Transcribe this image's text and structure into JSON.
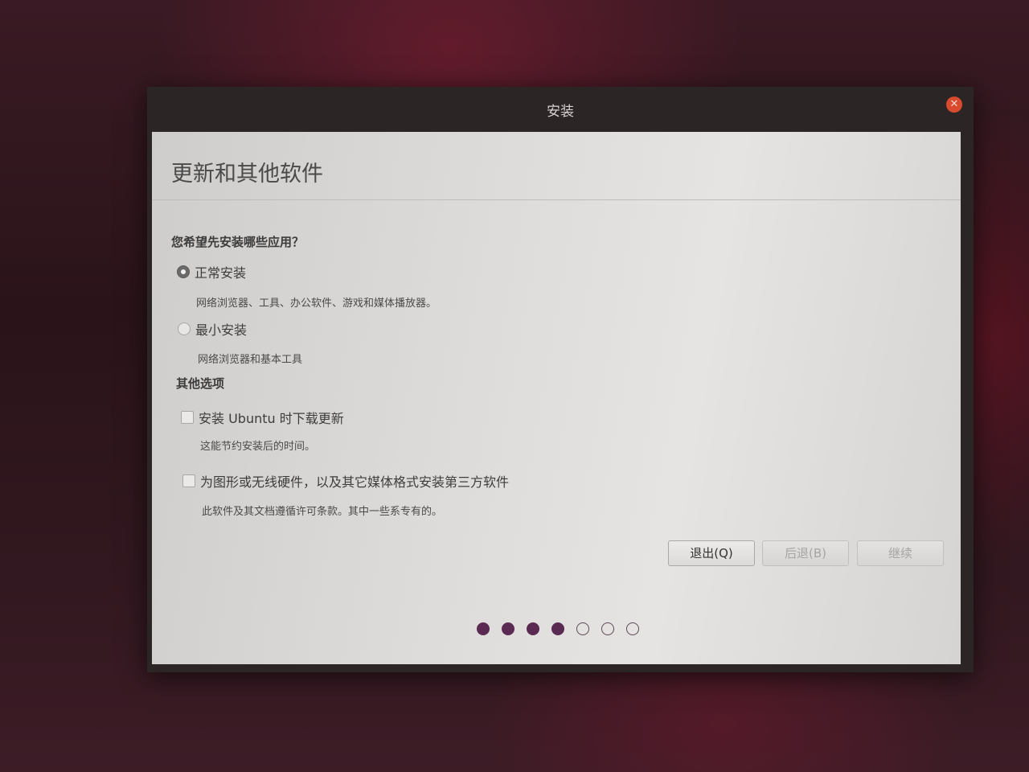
{
  "window": {
    "title": "安装"
  },
  "page": {
    "title": "更新和其他软件"
  },
  "install_type": {
    "heading": "您希望先安装哪些应用？",
    "options": [
      {
        "label": "正常安装",
        "description": "网络浏览器、工具、办公软件、游戏和媒体播放器。",
        "selected": true
      },
      {
        "label": "最小安装",
        "description": "网络浏览器和基本工具",
        "selected": false
      }
    ]
  },
  "other_options": {
    "heading": "其他选项",
    "options": [
      {
        "label": "安装 Ubuntu 时下载更新",
        "description": "这能节约安装后的时间。",
        "checked": false
      },
      {
        "label": "为图形或无线硬件，以及其它媒体格式安装第三方软件",
        "description": "此软件及其文档遵循许可条款。其中一些系专有的。",
        "checked": false
      }
    ]
  },
  "buttons": {
    "quit": "退出(Q)",
    "back": "后退(B)",
    "continue": "继续"
  },
  "progress": {
    "current_step": 4,
    "total_steps": 7
  },
  "colors": {
    "accent": "#5a2a52",
    "close_button": "#d94a2e"
  }
}
